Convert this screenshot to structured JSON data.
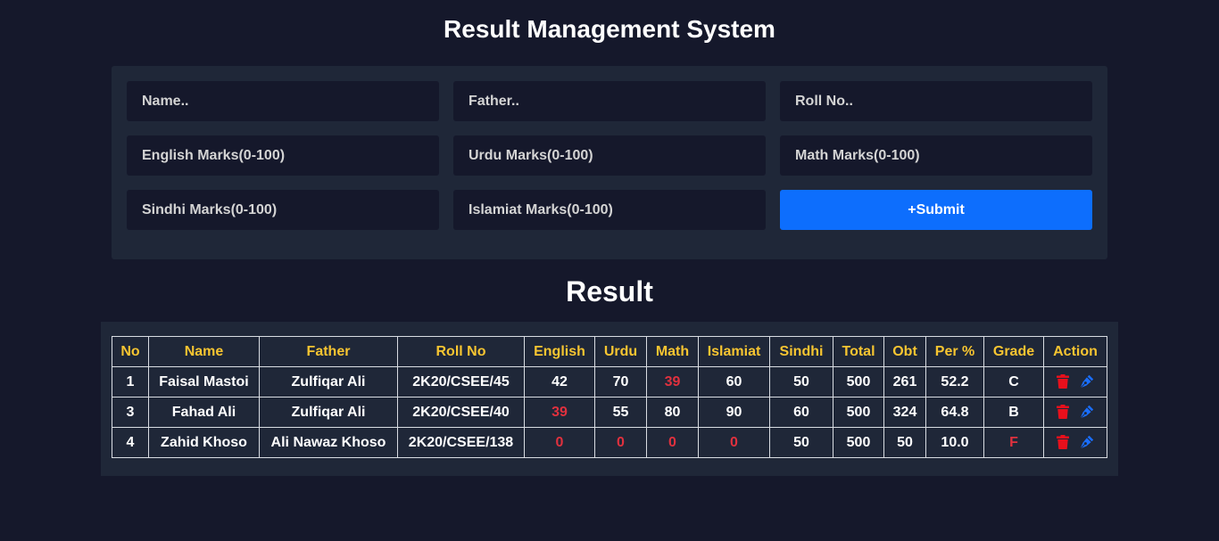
{
  "header": {
    "title": "Result Management System"
  },
  "form": {
    "name_placeholder": "Name..",
    "father_placeholder": "Father..",
    "roll_placeholder": "Roll No..",
    "english_placeholder": "English Marks(0-100)",
    "urdu_placeholder": "Urdu Marks(0-100)",
    "math_placeholder": "Math Marks(0-100)",
    "sindhi_placeholder": "Sindhi Marks(0-100)",
    "islamiat_placeholder": "Islamiat Marks(0-100)",
    "submit_label": "+Submit"
  },
  "results": {
    "title": "Result",
    "columns": [
      "No",
      "Name",
      "Father",
      "Roll No",
      "English",
      "Urdu",
      "Math",
      "Islamiat",
      "Sindhi",
      "Total",
      "Obt",
      "Per %",
      "Grade",
      "Action"
    ],
    "rows": [
      {
        "no": "1",
        "name": "Faisal Mastoi",
        "father": "Zulfiqar Ali",
        "roll": "2K20/CSEE/45",
        "english": "42",
        "urdu": "70",
        "math": "39",
        "islamiat": "60",
        "sindhi": "50",
        "total": "500",
        "obt": "261",
        "per": "52.2",
        "grade": "C"
      },
      {
        "no": "3",
        "name": "Fahad Ali",
        "father": "Zulfiqar Ali",
        "roll": "2K20/CSEE/40",
        "english": "39",
        "urdu": "55",
        "math": "80",
        "islamiat": "90",
        "sindhi": "60",
        "total": "500",
        "obt": "324",
        "per": "64.8",
        "grade": "B"
      },
      {
        "no": "4",
        "name": "Zahid Khoso",
        "father": "Ali Nawaz Khoso",
        "roll": "2K20/CSEE/138",
        "english": "0",
        "urdu": "0",
        "math": "0",
        "islamiat": "0",
        "sindhi": "50",
        "total": "500",
        "obt": "50",
        "per": "10.0",
        "grade": "F"
      }
    ],
    "icons": {
      "delete": "trash-icon",
      "edit": "pen-icon"
    }
  },
  "colors": {
    "background": "#15182b",
    "panel": "#1f2738",
    "header_text": "#f7c531",
    "fail_text": "#e0313e",
    "submit": "#0d6efd",
    "delete_icon": "#e8101c",
    "edit_icon": "#1a6efc"
  }
}
